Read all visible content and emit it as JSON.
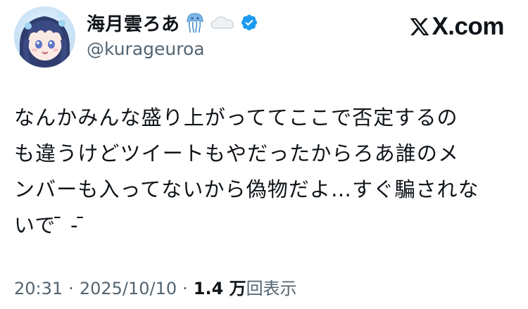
{
  "header": {
    "display_name": "海月雲ろあ",
    "handle": "@kurageuroa",
    "name_emojis": [
      "jellyfish-emoji",
      "cloud-emoji"
    ],
    "verified_badge_color": "#1d9bf0",
    "brand": "X.com"
  },
  "tweet": {
    "lines": [
      "なんかみんな盛り上がっててここで否定するの",
      "も違うけどツイートもやだったからろあ誰のメ",
      "ンバーも入ってないから偽物だよ…すぐ騙されな",
      "いで ̄ ‐  ̄"
    ]
  },
  "meta": {
    "time": "20:31",
    "separator": "·",
    "date": "2025/10/10",
    "views_count": "1.4 万",
    "views_label": "回表示"
  },
  "colors": {
    "text": "#0f1419",
    "secondary": "#536471",
    "verified": "#1d9bf0"
  }
}
